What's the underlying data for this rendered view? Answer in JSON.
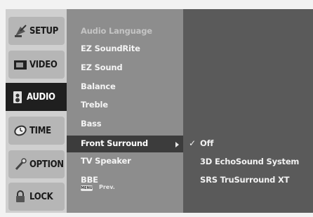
{
  "sidebar": {
    "tabs": [
      {
        "label": "SETUP",
        "icon": "satellite-dish-icon"
      },
      {
        "label": "VIDEO",
        "icon": "screen-icon"
      },
      {
        "label": "AUDIO",
        "icon": "speaker-icon"
      },
      {
        "label": "TIME",
        "icon": "clock-icon"
      },
      {
        "label": "OPTION",
        "icon": "wrench-icon"
      },
      {
        "label": "LOCK",
        "icon": "padlock-icon"
      }
    ],
    "active_tab": "AUDIO"
  },
  "submenu": {
    "items": [
      {
        "label": "Audio Language",
        "state": "disabled"
      },
      {
        "label": "EZ SoundRite",
        "state": "normal"
      },
      {
        "label": "EZ Sound",
        "state": "normal"
      },
      {
        "label": "Balance",
        "state": "normal"
      },
      {
        "label": "Treble",
        "state": "normal"
      },
      {
        "label": "Bass",
        "state": "normal"
      },
      {
        "label": "Front Surround",
        "state": "selected"
      },
      {
        "label": "TV Speaker",
        "state": "normal"
      },
      {
        "label": "BBE",
        "state": "normal"
      }
    ],
    "footer_badge": "MENU",
    "footer_text": "Prev."
  },
  "options": {
    "items": [
      {
        "label": "Off",
        "checked": true
      },
      {
        "label": "3D EchoSound System",
        "checked": false
      },
      {
        "label": "SRS TruSurround XT",
        "checked": false
      }
    ],
    "check_glyph": "✓"
  },
  "colors": {
    "sidebar_bg": "#cfcfcf",
    "active_tab": "#1f1f1f",
    "submenu_bg": "#8d8d8d",
    "highlight": "#3c3c3c",
    "options_bg": "#5a5a5a"
  }
}
